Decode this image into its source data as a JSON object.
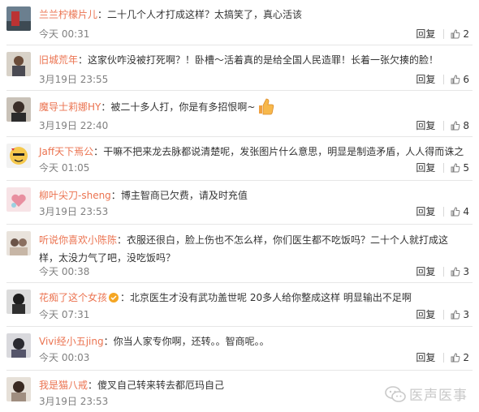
{
  "comments": [
    {
      "user": "兰兰柠檬片儿",
      "text": "二十几个人才打成这样？太搞笑了，真心活该",
      "time": "今天 00:31",
      "reply": "回复",
      "likes": "2"
    },
    {
      "user": "旧城荒年",
      "text": "这家伙咋没被打死啊？！卧槽～活着真的是给全国人民造罪！长着一张欠揍的脸！",
      "time": "3月19日 23:55",
      "reply": "回复",
      "likes": "6"
    },
    {
      "user": "魔导士莉娜HY",
      "text": "被二十多人打，你是有多招恨啊~",
      "time": "3月19日 22:40",
      "reply": "回复",
      "likes": "8"
    },
    {
      "user": "Jaff天下焉公",
      "text": "干嘛不把来龙去脉都说清楚呢，发张图片什么意思，明显是制造矛盾，人人得而诛之",
      "time": "今天 01:05",
      "reply": "回复",
      "likes": "5"
    },
    {
      "user": "柳叶尖刀-sheng",
      "text": "博主智商已欠费，请及时充值",
      "time": "3月19日 23:53",
      "reply": "回复",
      "likes": "4"
    },
    {
      "user": "听说你喜欢小陈陈",
      "text": "衣服还很白，脸上伤也不怎么样，你们医生都不吃饭吗？二十个人就打成这样，太没力气了吧，没吃饭吗？",
      "time": "今天 00:38",
      "reply": "回复",
      "likes": "3"
    },
    {
      "user": "花痴了这个女孩",
      "text": "北京医生才没有武功盖世呢 20多人给你整成这样 明显输出不足啊",
      "time": "今天 07:31",
      "reply": "回复",
      "likes": "3"
    },
    {
      "user": "Vivi经小五jing",
      "text": "你当人家专你啊，还转。。智商呢。。",
      "time": "今天 00:03",
      "reply": "回复",
      "likes": "2"
    },
    {
      "user": "我是猫八戒",
      "text": "傻叉自己转来转去都厄玛自己",
      "time": "3月19日 23:53",
      "reply": "",
      "likes": ""
    }
  ],
  "watermark": {
    "text": "医声医事",
    "icon": "wechat-icon"
  },
  "colors": {
    "username": "#eb7350",
    "time": "#808080",
    "divider": "#e6e6e6",
    "like_icon": "#808080"
  }
}
